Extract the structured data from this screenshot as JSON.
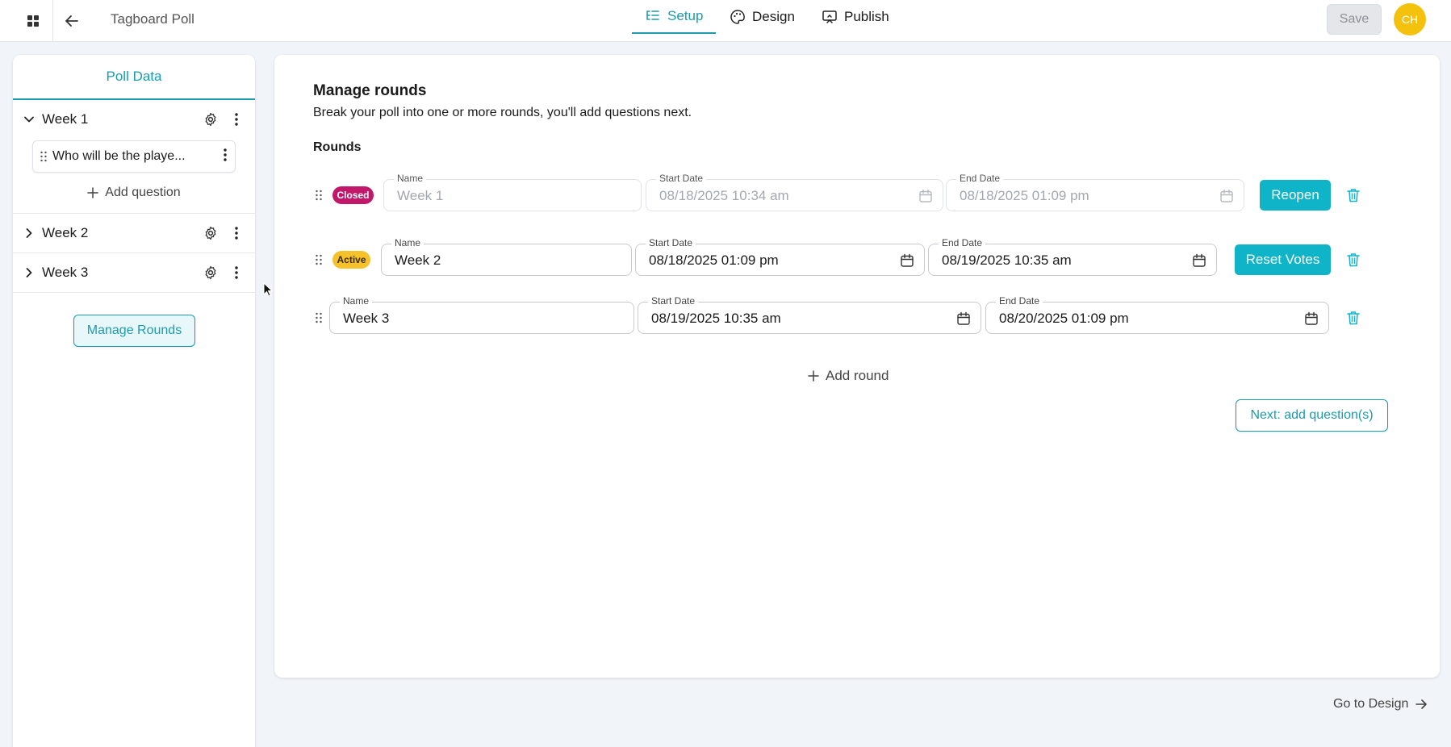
{
  "app": {
    "title": "Tagboard Poll"
  },
  "nav": {
    "tabs": [
      {
        "label": "Setup",
        "icon": "list-tree-icon",
        "active": true
      },
      {
        "label": "Design",
        "icon": "palette-icon",
        "active": false
      },
      {
        "label": "Publish",
        "icon": "presentation-icon",
        "active": false
      }
    ]
  },
  "toolbar": {
    "save_label": "Save",
    "avatar_initials": "CH"
  },
  "sidebar": {
    "header": "Poll Data",
    "weeks": [
      {
        "label": "Week 1",
        "expanded": true,
        "questions": [
          "Who will be the playe..."
        ]
      },
      {
        "label": "Week 2",
        "expanded": false
      },
      {
        "label": "Week 3",
        "expanded": false
      }
    ],
    "add_question_label": "Add question",
    "manage_rounds_label": "Manage Rounds"
  },
  "main": {
    "title": "Manage rounds",
    "subtitle": "Break your poll into one or more rounds, you'll add questions next.",
    "rounds_label": "Rounds",
    "field_labels": {
      "name": "Name",
      "start": "Start Date",
      "end": "End Date"
    },
    "rounds": [
      {
        "status": "Closed",
        "name": "Week 1",
        "start": "08/18/2025 10:34 am",
        "end": "08/18/2025 01:09 pm",
        "action": "Reopen"
      },
      {
        "status": "Active",
        "name": "Week 2",
        "start": "08/18/2025 01:09 pm",
        "end": "08/19/2025 10:35 am",
        "action": "Reset Votes"
      },
      {
        "status": "",
        "name": "Week 3",
        "start": "08/19/2025 10:35 am",
        "end": "08/20/2025 01:09 pm",
        "action": ""
      }
    ],
    "add_round_label": "Add round",
    "next_label": "Next: add question(s)"
  },
  "footer": {
    "go_design_label": "Go to Design"
  },
  "colors": {
    "accent": "#1a9cad",
    "button": "#10b4c8",
    "closed": "#c2186b",
    "active": "#f5c22c",
    "avatar": "#f4c20d"
  }
}
